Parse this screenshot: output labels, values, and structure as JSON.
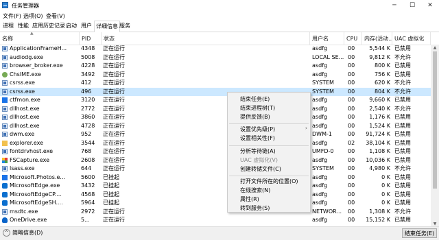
{
  "window": {
    "title": "任务管理器",
    "minimize_glyph": "─",
    "maximize_glyph": "☐",
    "close_glyph": "✕"
  },
  "menu": [
    "文件(F)",
    "选项(O)",
    "查看(V)"
  ],
  "tabs": [
    "进程",
    "性能",
    "应用历史记录",
    "启动",
    "用户",
    "详细信息",
    "服务"
  ],
  "active_tab": "详细信息",
  "columns": [
    "名称",
    "PID",
    "状态",
    "用户名",
    "CPU",
    "内存(活动...",
    "UAC 虚拟化"
  ],
  "processes": [
    {
      "name": "ApplicationFrameH...",
      "pid": "4348",
      "status": "正在运行",
      "user": "asdfg",
      "cpu": "00",
      "mem": "5,544 K",
      "uac": "已禁用",
      "icon": "window-icon"
    },
    {
      "name": "audiodg.exe",
      "pid": "5008",
      "status": "正在运行",
      "user": "LOCAL SE...",
      "cpu": "00",
      "mem": "9,812 K",
      "uac": "不允许",
      "icon": "window-icon"
    },
    {
      "name": "browser_broker.exe",
      "pid": "4228",
      "status": "正在运行",
      "user": "asdfg",
      "cpu": "00",
      "mem": "800 K",
      "uac": "已禁用",
      "icon": "window-icon"
    },
    {
      "name": "ChsIME.exe",
      "pid": "3492",
      "status": "正在运行",
      "user": "asdfg",
      "cpu": "00",
      "mem": "756 K",
      "uac": "已禁用",
      "icon": "ime-icon"
    },
    {
      "name": "csrss.exe",
      "pid": "412",
      "status": "正在运行",
      "user": "SYSTEM",
      "cpu": "00",
      "mem": "620 K",
      "uac": "不允许",
      "icon": "window-icon"
    },
    {
      "name": "csrss.exe",
      "pid": "496",
      "status": "正在运行",
      "user": "SYSTEM",
      "cpu": "00",
      "mem": "804 K",
      "uac": "不允许",
      "icon": "window-icon",
      "selected": true
    },
    {
      "name": "ctfmon.exe",
      "pid": "3120",
      "status": "正在运行",
      "user": "asdfg",
      "cpu": "00",
      "mem": "9,660 K",
      "uac": "已禁用",
      "icon": "ctf-icon"
    },
    {
      "name": "dllhost.exe",
      "pid": "2772",
      "status": "正在运行",
      "user": "asdfg",
      "cpu": "00",
      "mem": "2,540 K",
      "uac": "不允许",
      "icon": "window-icon"
    },
    {
      "name": "dllhost.exe",
      "pid": "3860",
      "status": "正在运行",
      "user": "asdfg",
      "cpu": "00",
      "mem": "1,176 K",
      "uac": "已禁用",
      "icon": "window-icon"
    },
    {
      "name": "dllhost.exe",
      "pid": "4728",
      "status": "正在运行",
      "user": "asdfg",
      "cpu": "00",
      "mem": "1,524 K",
      "uac": "已禁用",
      "icon": "window-icon"
    },
    {
      "name": "dwm.exe",
      "pid": "952",
      "status": "正在运行",
      "user": "DWM-1",
      "cpu": "00",
      "mem": "91,724 K",
      "uac": "已禁用",
      "icon": "window-icon"
    },
    {
      "name": "explorer.exe",
      "pid": "3544",
      "status": "正在运行",
      "user": "asdfg",
      "cpu": "02",
      "mem": "38,104 K",
      "uac": "已禁用",
      "icon": "folder-icon"
    },
    {
      "name": "fontdrvhost.exe",
      "pid": "768",
      "status": "正在运行",
      "user": "UMFD-0",
      "cpu": "00",
      "mem": "1,108 K",
      "uac": "已禁用",
      "icon": "window-icon"
    },
    {
      "name": "FSCapture.exe",
      "pid": "2608",
      "status": "正在运行",
      "user": "asdfg",
      "cpu": "00",
      "mem": "10,036 K",
      "uac": "已禁用",
      "icon": "capture-icon"
    },
    {
      "name": "lsass.exe",
      "pid": "644",
      "status": "正在运行",
      "user": "SYSTEM",
      "cpu": "00",
      "mem": "4,980 K",
      "uac": "不允许",
      "icon": "window-icon"
    },
    {
      "name": "Microsoft.Photos.e...",
      "pid": "5600",
      "status": "已挂起",
      "user": "asdfg",
      "cpu": "00",
      "mem": "0 K",
      "uac": "已禁用",
      "icon": "photos-icon"
    },
    {
      "name": "MicrosoftEdge.exe",
      "pid": "3432",
      "status": "已挂起",
      "user": "asdfg",
      "cpu": "00",
      "mem": "0 K",
      "uac": "已禁用",
      "icon": "edge-icon"
    },
    {
      "name": "MicrosoftEdgeCP....",
      "pid": "4568",
      "status": "已挂起",
      "user": "asdfg",
      "cpu": "00",
      "mem": "0 K",
      "uac": "已禁用",
      "icon": "edge-icon"
    },
    {
      "name": "MicrosoftEdgeSH....",
      "pid": "5964",
      "status": "已挂起",
      "user": "asdfg",
      "cpu": "00",
      "mem": "0 K",
      "uac": "已禁用",
      "icon": "edge-icon"
    },
    {
      "name": "msdtc.exe",
      "pid": "2972",
      "status": "正在运行",
      "user": "NETWOR...",
      "cpu": "00",
      "mem": "1,308 K",
      "uac": "不允许",
      "icon": "window-icon"
    },
    {
      "name": "OneDrive.exe",
      "pid": "5...",
      "status": "正在运行",
      "user": "asdfg",
      "cpu": "00",
      "mem": "15,152 K",
      "uac": "已禁用",
      "icon": "onedrive-icon"
    }
  ],
  "context_menu": [
    {
      "label": "结束任务(E)"
    },
    {
      "label": "结束进程树(T)"
    },
    {
      "label": "提供反馈(B)"
    },
    {
      "separator": true
    },
    {
      "label": "设置优先级(P)",
      "submenu": true
    },
    {
      "label": "设置相关性(F)"
    },
    {
      "separator": true
    },
    {
      "label": "分析等待链(A)"
    },
    {
      "label": "UAC 虚拟化(V)",
      "disabled": true
    },
    {
      "label": "创建转储文件(C)"
    },
    {
      "separator": true
    },
    {
      "label": "打开文件所在的位置(O)"
    },
    {
      "label": "在线搜索(N)"
    },
    {
      "label": "属性(R)"
    },
    {
      "label": "转到服务(S)"
    }
  ],
  "footer": {
    "less_details": "简略信息(D)",
    "end_task": "结束任务(E)"
  },
  "colors": {
    "selected_row": "#cce8ff",
    "context_menu_bg": "#f2f2f2",
    "footer_bg": "#f0f0f0"
  }
}
